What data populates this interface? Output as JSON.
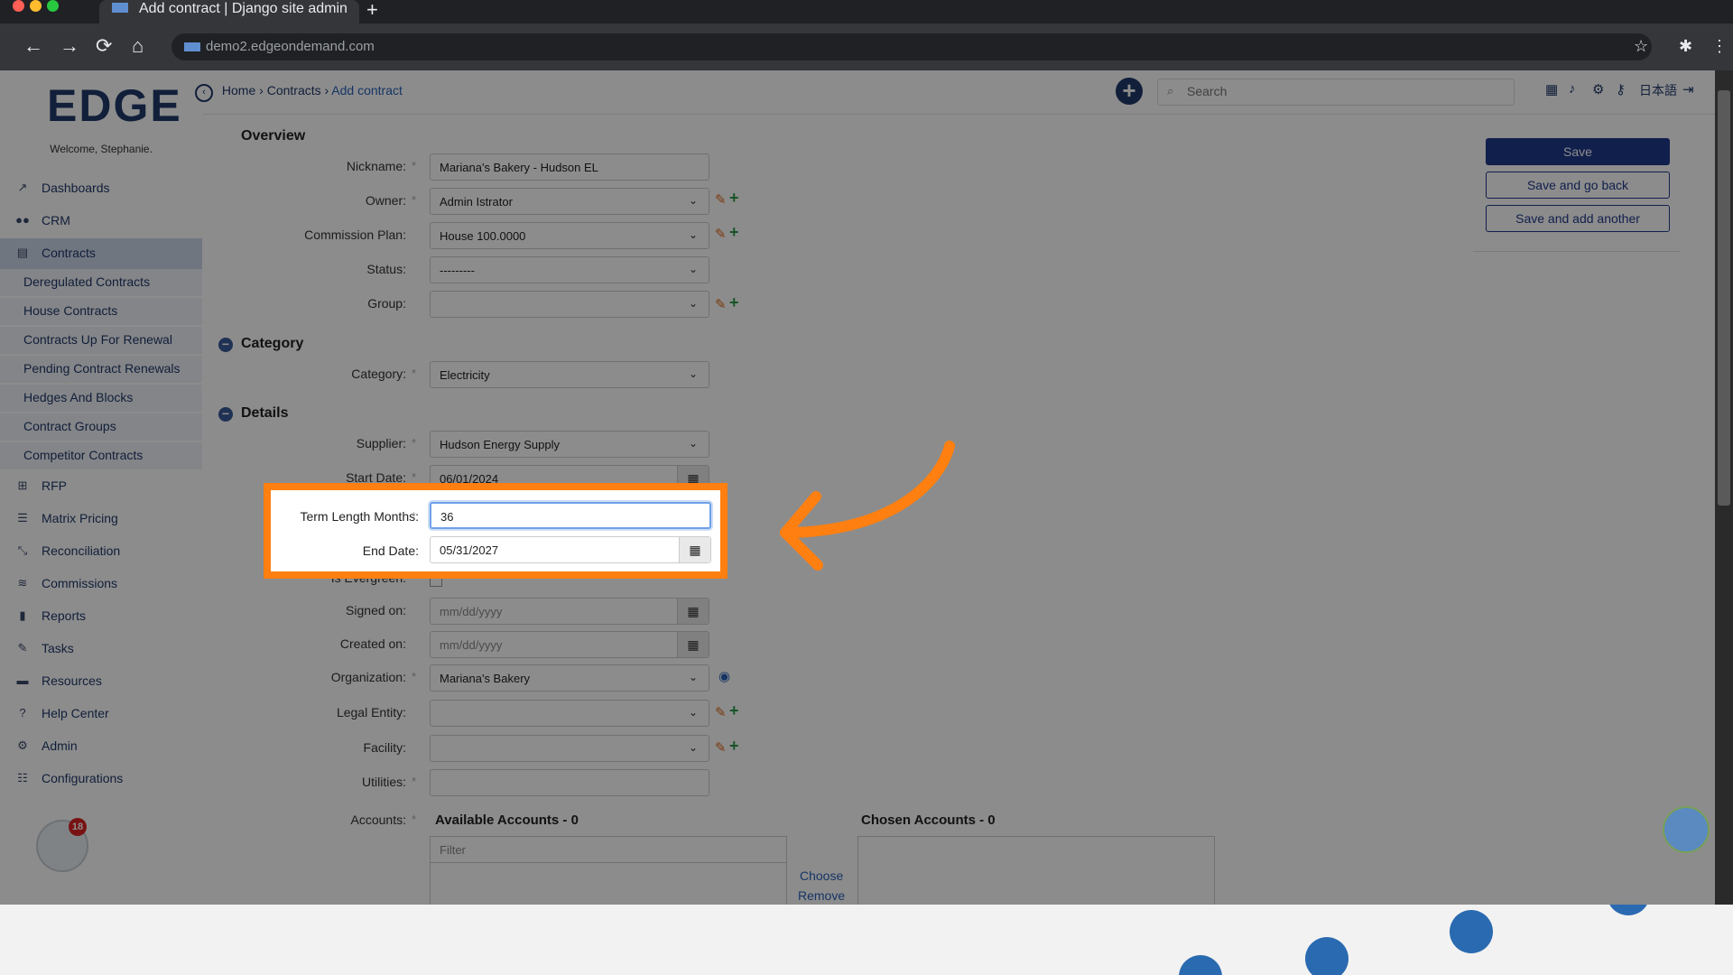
{
  "browser": {
    "tab_title": "Add contract | Django site admin",
    "new_tab": "+",
    "url": "demo2.edgeondemand.com",
    "nav": {
      "back": "←",
      "forward": "→",
      "reload": "⟳",
      "home": "⌂"
    },
    "right_icons": {
      "star": "☆",
      "extensions": "✱",
      "menu": "⋮"
    }
  },
  "sidebar": {
    "logo": "EDGE",
    "welcome": "Welcome, Stephanie.",
    "items": [
      {
        "label": "Dashboards",
        "icon": "chart-line-icon",
        "glyph": "📈"
      },
      {
        "label": "CRM",
        "icon": "users-icon",
        "glyph": "👥"
      },
      {
        "label": "Contracts",
        "icon": "file-icon",
        "glyph": "📄"
      },
      {
        "label": "RFP",
        "icon": "sitemap-icon",
        "glyph": "⊞"
      },
      {
        "label": "Matrix Pricing",
        "icon": "list-icon",
        "glyph": "☰"
      },
      {
        "label": "Reconciliation",
        "icon": "compress-icon",
        "glyph": "⤡"
      },
      {
        "label": "Commissions",
        "icon": "coins-icon",
        "glyph": "≋"
      },
      {
        "label": "Reports",
        "icon": "bar-chart-icon",
        "glyph": "▮"
      },
      {
        "label": "Tasks",
        "icon": "tasks-icon",
        "glyph": "✎"
      },
      {
        "label": "Resources",
        "icon": "folder-icon",
        "glyph": "▬"
      },
      {
        "label": "Help Center",
        "icon": "question-icon",
        "glyph": "?"
      },
      {
        "label": "Admin",
        "icon": "cogs-icon",
        "glyph": "⚙"
      },
      {
        "label": "Configurations",
        "icon": "sliders-icon",
        "glyph": "☰"
      }
    ],
    "contracts_sub": [
      "Deregulated Contracts",
      "House Contracts",
      "Contracts Up For Renewal",
      "Pending Contract Renewals",
      "Hedges And Blocks",
      "Contract Groups",
      "Competitor Contracts"
    ],
    "badge_count": "18"
  },
  "topbar": {
    "crumb_home": "Home",
    "crumb_contracts": "Contracts",
    "crumb_current": "Add contract",
    "search_placeholder": "Search",
    "lang": "日本語"
  },
  "form": {
    "overview": "Overview",
    "category_section": "Category",
    "details_section": "Details",
    "nickname_label": "Nickname:",
    "nickname": "Mariana's Bakery - Hudson EL",
    "owner_label": "Owner:",
    "owner": "Admin Istrator",
    "commission_label": "Commission Plan:",
    "commission": "House 100.0000",
    "status_label": "Status:",
    "status": "---------",
    "group_label": "Group:",
    "group": "",
    "category_label": "Category:",
    "category": "Electricity",
    "supplier_label": "Supplier:",
    "supplier": "Hudson Energy Supply",
    "start_label": "Start Date:",
    "start_date": "06/01/2024",
    "term_label": "Term Length Months:",
    "term": "36",
    "end_label": "End Date:",
    "end_date": "05/31/2027",
    "evergreen_label": "Is Evergreen:",
    "signed_label": "Signed on:",
    "signed_placeholder": "mm/dd/yyyy",
    "created_label": "Created on:",
    "created_placeholder": "mm/dd/yyyy",
    "org_label": "Organization:",
    "organization": "Mariana's Bakery",
    "legal_label": "Legal Entity:",
    "facility_label": "Facility:",
    "utilities_label": "Utilities:",
    "accounts_label": "Accounts:",
    "available_header": "Available Accounts - 0",
    "chosen_header": "Chosen Accounts - 0",
    "filter_placeholder": "Filter",
    "choose": "Choose",
    "remove": "Remove"
  },
  "buttons": {
    "save": "Save",
    "save_back": "Save and go back",
    "save_add": "Save and add another"
  },
  "colors": {
    "brand": "#203a6a",
    "highlight": "#ff7f10",
    "link": "#2a62b8"
  }
}
